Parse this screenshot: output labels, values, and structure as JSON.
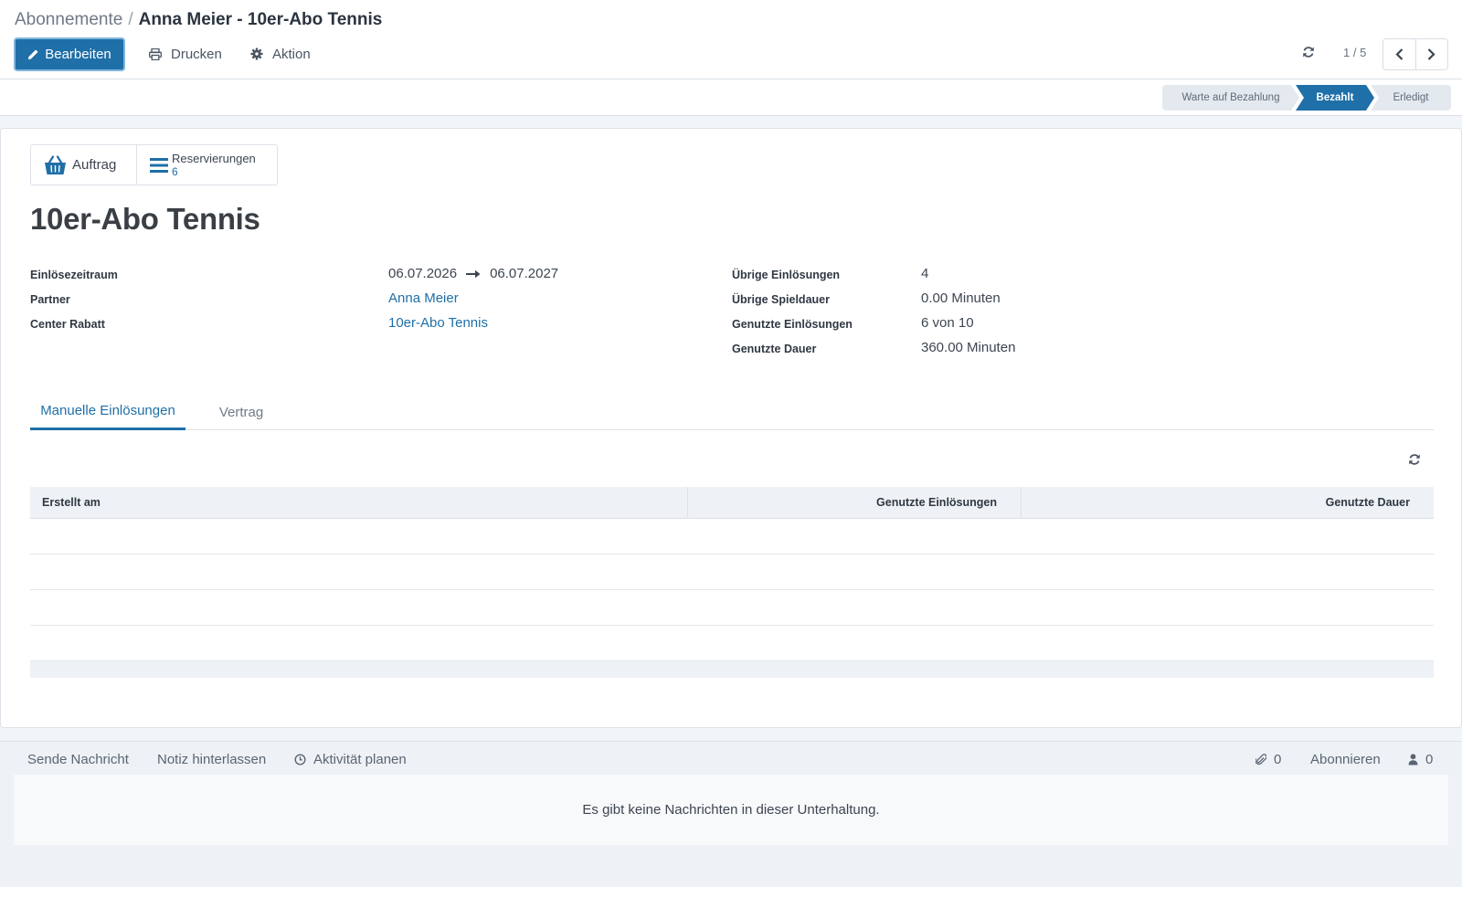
{
  "breadcrumb": {
    "parent": "Abonnemente",
    "separator": "/",
    "current": "Anna Meier - 10er-Abo Tennis"
  },
  "toolbar": {
    "edit_label": "Bearbeiten",
    "print_label": "Drucken",
    "action_label": "Aktion"
  },
  "pager": {
    "value": "1 / 5"
  },
  "statusbar": {
    "stages": [
      "Warte auf Bezahlung",
      "Bezahlt",
      "Erledigt"
    ],
    "active": "Bezahlt"
  },
  "smart_buttons": {
    "order_label": "Auftrag",
    "reservations_label": "Reservierungen",
    "reservations_count": "6"
  },
  "record": {
    "title": "10er-Abo Tennis",
    "left_fields": {
      "period_label": "Einlösezeitraum",
      "period_start": "06.07.2026",
      "period_end": "06.07.2027",
      "partner_label": "Partner",
      "partner_value": "Anna Meier",
      "discount_label": "Center Rabatt",
      "discount_value": "10er-Abo Tennis"
    },
    "right_fields": {
      "remaining_label": "Übrige Einlösungen",
      "remaining_value": "4",
      "remaining_duration_label": "Übrige Spieldauer",
      "remaining_duration_value": "0.00 Minuten",
      "used_label": "Genutzte Einlösungen",
      "used_value": "6 von 10",
      "used_duration_label": "Genutzte Dauer",
      "used_duration_value": "360.00 Minuten"
    }
  },
  "tabs": {
    "manual": "Manuelle Einlösungen",
    "contract": "Vertrag"
  },
  "list": {
    "columns": [
      "Erstellt am",
      "Genutzte Einlösungen",
      "Genutzte Dauer"
    ]
  },
  "chatter": {
    "send_message": "Sende Nachricht",
    "log_note": "Notiz hinterlassen",
    "schedule_activity": "Aktivität planen",
    "attachments_count": "0",
    "follow": "Abonnieren",
    "followers_count": "0",
    "empty_text": "Es gibt keine Nachrichten in dieser Unterhaltung."
  },
  "colors": {
    "primary": "#1f6fa8",
    "background": "#f1f4f8"
  }
}
